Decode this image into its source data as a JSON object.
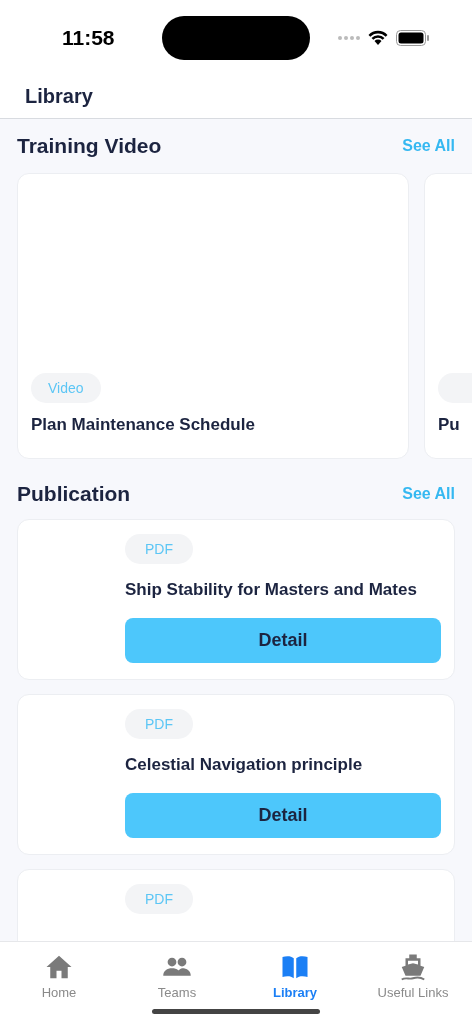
{
  "status_bar": {
    "time": "11:58"
  },
  "header": {
    "title": "Library"
  },
  "training": {
    "title": "Training Video",
    "see_all": "See All",
    "videos": [
      {
        "badge": "Video",
        "title": "Plan Maintenance Schedule"
      },
      {
        "title": "Pu"
      }
    ]
  },
  "publication": {
    "title": "Publication",
    "see_all": "See All",
    "items": [
      {
        "badge": "PDF",
        "title": "Ship Stability for Masters and Mates",
        "button": "Detail"
      },
      {
        "badge": "PDF",
        "title": "Celestial Navigation principle",
        "button": "Detail"
      },
      {
        "badge": "PDF"
      }
    ]
  },
  "tab_bar": [
    {
      "label": "Home",
      "kind": "home",
      "selected": false
    },
    {
      "label": "Teams",
      "kind": "teams",
      "selected": false
    },
    {
      "label": "Library",
      "kind": "book",
      "selected": true
    },
    {
      "label": "Useful Links",
      "kind": "ship",
      "selected": false
    }
  ]
}
